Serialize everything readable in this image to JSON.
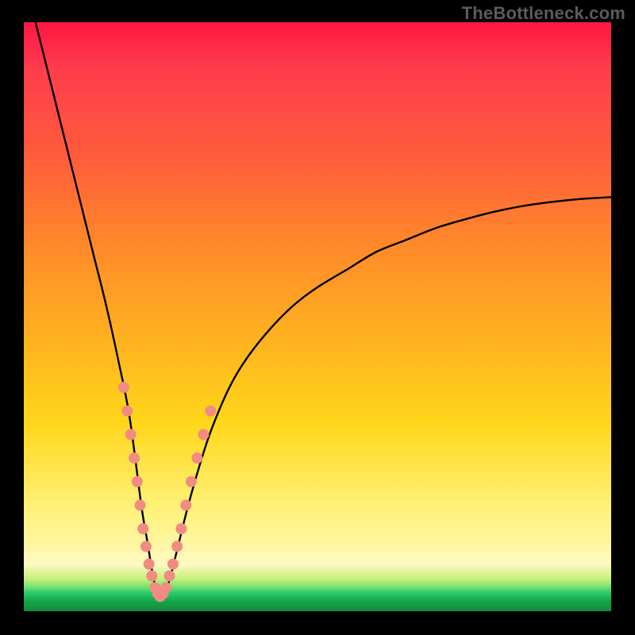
{
  "watermark": {
    "text": "TheBottleneck.com"
  },
  "colors": {
    "curve_stroke": "#000000",
    "marker_fill": "#f28b82",
    "marker_stroke": "#d46a62"
  },
  "chart_data": {
    "type": "line",
    "title": "",
    "xlabel": "",
    "ylabel": "",
    "xlim": [
      0,
      100
    ],
    "ylim": [
      0,
      100
    ],
    "grid": false,
    "legend": false,
    "notes": "V-shaped bottleneck curve. y-axis inverted visually (higher value = worse = red, minimum = green band at bottom). Minimum around x≈23, y≈2. Left branch steep, right branch shallower asymptote ~70.",
    "series": [
      {
        "name": "bottleneck-curve",
        "x": [
          2,
          4,
          6,
          8,
          10,
          12,
          14,
          16,
          18,
          20,
          21,
          22,
          23,
          24,
          25,
          26,
          28,
          30,
          32,
          35,
          38,
          42,
          46,
          50,
          55,
          60,
          65,
          70,
          75,
          80,
          85,
          90,
          95,
          100
        ],
        "y": [
          100,
          92,
          84,
          76,
          68,
          60,
          52,
          43,
          33,
          18,
          12,
          6,
          2,
          3,
          6,
          10,
          18,
          25,
          31,
          38,
          43,
          48,
          52,
          55,
          58,
          61,
          63,
          65,
          66.5,
          67.8,
          68.8,
          69.5,
          70,
          70.3
        ]
      }
    ],
    "markers": {
      "name": "highlight-dots",
      "note": "Pink dots clustered on both branches near the minimum, roughly in the y≈5–35 band.",
      "points": [
        {
          "x": 17.0,
          "y": 38
        },
        {
          "x": 17.6,
          "y": 34
        },
        {
          "x": 18.2,
          "y": 30
        },
        {
          "x": 18.8,
          "y": 26
        },
        {
          "x": 19.3,
          "y": 22
        },
        {
          "x": 19.8,
          "y": 18
        },
        {
          "x": 20.3,
          "y": 14
        },
        {
          "x": 20.8,
          "y": 11
        },
        {
          "x": 21.3,
          "y": 8
        },
        {
          "x": 21.8,
          "y": 6
        },
        {
          "x": 22.3,
          "y": 4
        },
        {
          "x": 22.8,
          "y": 3
        },
        {
          "x": 23.2,
          "y": 2.5
        },
        {
          "x": 23.7,
          "y": 3
        },
        {
          "x": 24.2,
          "y": 4
        },
        {
          "x": 24.8,
          "y": 6
        },
        {
          "x": 25.4,
          "y": 8
        },
        {
          "x": 26.1,
          "y": 11
        },
        {
          "x": 26.8,
          "y": 14
        },
        {
          "x": 27.6,
          "y": 18
        },
        {
          "x": 28.5,
          "y": 22
        },
        {
          "x": 29.5,
          "y": 26
        },
        {
          "x": 30.6,
          "y": 30
        },
        {
          "x": 31.8,
          "y": 34
        }
      ]
    }
  }
}
